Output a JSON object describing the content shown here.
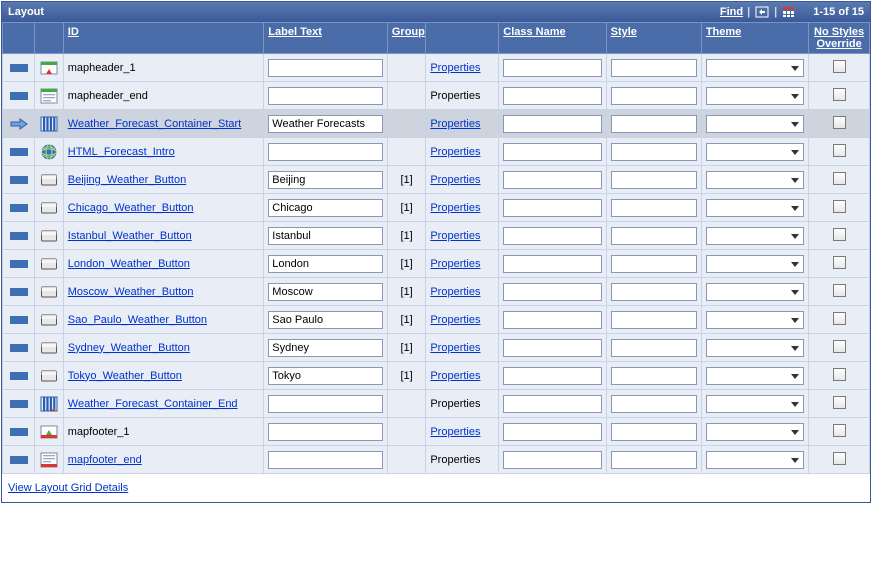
{
  "titlebar": {
    "title": "Layout",
    "find": "Find",
    "count": "1-15 of 15"
  },
  "headers": {
    "id": "ID",
    "label": "Label Text",
    "group": "Group",
    "class": "Class Name",
    "style": "Style",
    "theme": "Theme",
    "nso": "No Styles Override"
  },
  "rows": [
    {
      "marker": "bar",
      "icon": "header",
      "id": "mapheader_1",
      "link": false,
      "label": "",
      "group": "",
      "propLink": true
    },
    {
      "marker": "bar",
      "icon": "header-end",
      "id": "mapheader_end",
      "link": false,
      "label": "",
      "group": "",
      "propLink": false
    },
    {
      "marker": "arrow",
      "icon": "container-start",
      "id": "Weather_Forecast_Container_Start",
      "link": true,
      "label": "Weather Forecasts",
      "group": "",
      "propLink": true,
      "selected": true
    },
    {
      "marker": "bar",
      "icon": "html",
      "id": "HTML_Forecast_Intro",
      "link": true,
      "label": "",
      "group": "",
      "propLink": true
    },
    {
      "marker": "bar",
      "icon": "button",
      "id": "Beijing_Weather_Button",
      "link": true,
      "label": "Beijing",
      "group": "[1]",
      "propLink": true
    },
    {
      "marker": "bar",
      "icon": "button",
      "id": "Chicago_Weather_Button",
      "link": true,
      "label": "Chicago",
      "group": "[1]",
      "propLink": true
    },
    {
      "marker": "bar",
      "icon": "button",
      "id": "Istanbul_Weather_Button",
      "link": true,
      "label": "Istanbul",
      "group": "[1]",
      "propLink": true
    },
    {
      "marker": "bar",
      "icon": "button",
      "id": "London_Weather_Button",
      "link": true,
      "label": "London",
      "group": "[1]",
      "propLink": true
    },
    {
      "marker": "bar",
      "icon": "button",
      "id": "Moscow_Weather_Button",
      "link": true,
      "label": "Moscow",
      "group": "[1]",
      "propLink": true
    },
    {
      "marker": "bar",
      "icon": "button",
      "id": "Sao_Paulo_Weather_Button",
      "link": true,
      "label": "Sao Paulo",
      "group": "[1]",
      "propLink": true
    },
    {
      "marker": "bar",
      "icon": "button",
      "id": "Sydney_Weather_Button",
      "link": true,
      "label": "Sydney",
      "group": "[1]",
      "propLink": true
    },
    {
      "marker": "bar",
      "icon": "button",
      "id": "Tokyo_Weather_Button",
      "link": true,
      "label": "Tokyo",
      "group": "[1]",
      "propLink": true
    },
    {
      "marker": "bar",
      "icon": "container-end",
      "id": "Weather_Forecast_Container_End",
      "link": true,
      "label": "",
      "group": "",
      "propLink": false
    },
    {
      "marker": "bar",
      "icon": "footer",
      "id": "mapfooter_1",
      "link": false,
      "label": "",
      "group": "",
      "propLink": true
    },
    {
      "marker": "bar",
      "icon": "footer-end",
      "id": "mapfooter_end",
      "link": true,
      "label": "",
      "group": "",
      "propLink": false
    }
  ],
  "properties_label": "Properties",
  "footer": {
    "link": "View Layout Grid Details"
  }
}
